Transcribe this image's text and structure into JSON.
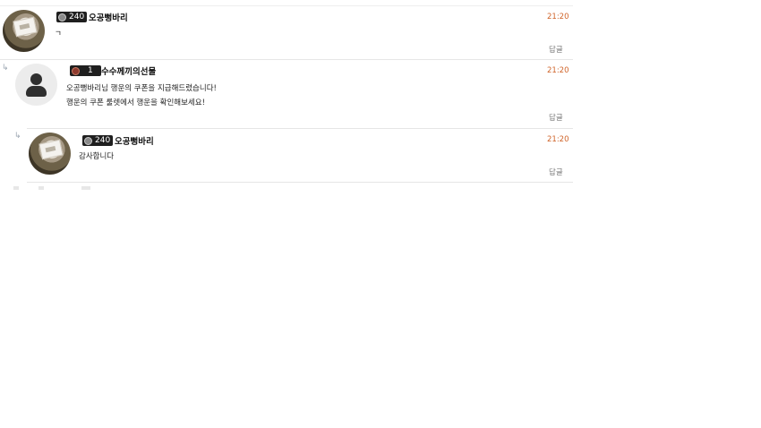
{
  "comments": [
    {
      "level": "240",
      "author": "오공뻥바리",
      "time": "21:20",
      "lines": [
        "ㄱ"
      ],
      "reply_label": "답글"
    },
    {
      "level": "1",
      "author": "수수께끼의선물",
      "time": "21:20",
      "lines": [
        "오공뻥바리님 행운의 쿠폰을 지급해드렸습니다!",
        "행운의 쿠폰 룰렛에서 행운을 확인해보세요!"
      ],
      "reply_label": "답글"
    },
    {
      "level": "240",
      "author": "오공뻥바리",
      "time": "21:20",
      "lines": [
        "감사합니다"
      ],
      "reply_label": "답글"
    }
  ],
  "icons": {
    "reply_arrow": "reply-arrow-icon",
    "level_emblem": "level-emblem-icon",
    "default_avatar": "user-silhouette-icon"
  },
  "colors": {
    "time": "#d0642a",
    "badge_bg": "#1f1f1f",
    "divider": "#e6e6e6"
  }
}
